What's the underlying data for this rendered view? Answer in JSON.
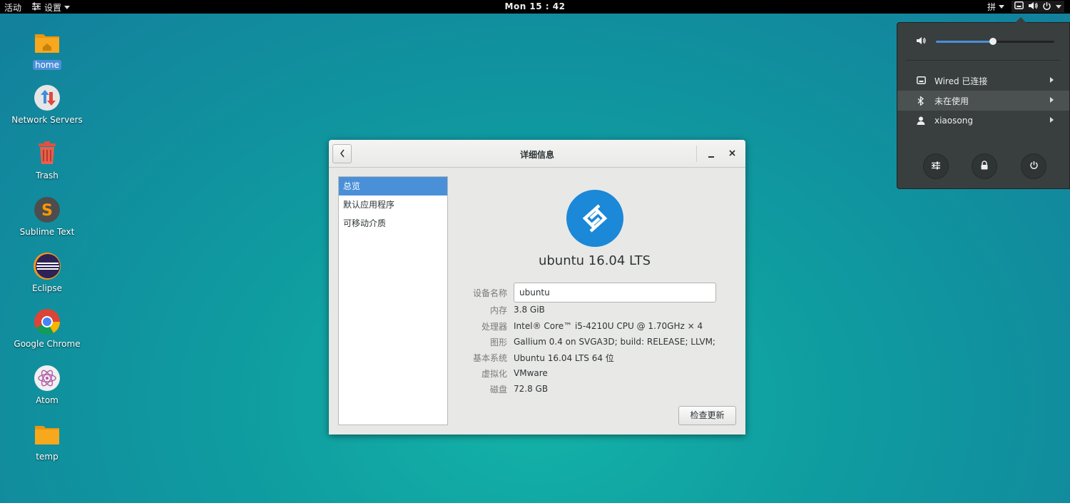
{
  "topbar": {
    "activities": "活动",
    "app_menu": "设置",
    "clock": "Mon 15 : 42",
    "input_method": "拼"
  },
  "desktop": {
    "icons": [
      {
        "label": "home",
        "icon": "folder-home-icon"
      },
      {
        "label": "Network Servers",
        "icon": "network-servers-icon"
      },
      {
        "label": "Trash",
        "icon": "trash-icon"
      },
      {
        "label": "Sublime Text",
        "icon": "sublime-text-icon"
      },
      {
        "label": "Eclipse",
        "icon": "eclipse-icon"
      },
      {
        "label": "Google Chrome",
        "icon": "chrome-icon"
      },
      {
        "label": "Atom",
        "icon": "atom-icon"
      },
      {
        "label": "temp",
        "icon": "folder-icon"
      }
    ]
  },
  "window": {
    "title": "详细信息",
    "sidebar": [
      "总览",
      "默认应用程序",
      "可移动介质"
    ],
    "os_name": "ubuntu 16.04 LTS",
    "device_name_label": "设备名称",
    "device_name_value": "ubuntu",
    "memory_label": "内存",
    "memory_value": "3.8 GiB",
    "processor_label": "处理器",
    "processor_value": "Intel® Core™ i5-4210U CPU @ 1.70GHz × 4",
    "graphics_label": "图形",
    "graphics_value": "Gallium 0.4 on SVGA3D; build: RELEASE;  LLVM;",
    "base_system_label": "基本系统",
    "base_system_value": "Ubuntu 16.04 LTS 64 位",
    "virtualization_label": "虚拟化",
    "virtualization_value": "VMware",
    "disk_label": "磁盘",
    "disk_value": "72.8 GB",
    "update_button": "检查更新"
  },
  "system_menu": {
    "volume_level": 0.48,
    "wired": "Wired 已连接",
    "bluetooth": "未在使用",
    "user": "xiaosong"
  },
  "colors": {
    "accent": "#4a90d9",
    "logo_blue": "#1b88d8",
    "menu_bg": "#393f3f"
  }
}
